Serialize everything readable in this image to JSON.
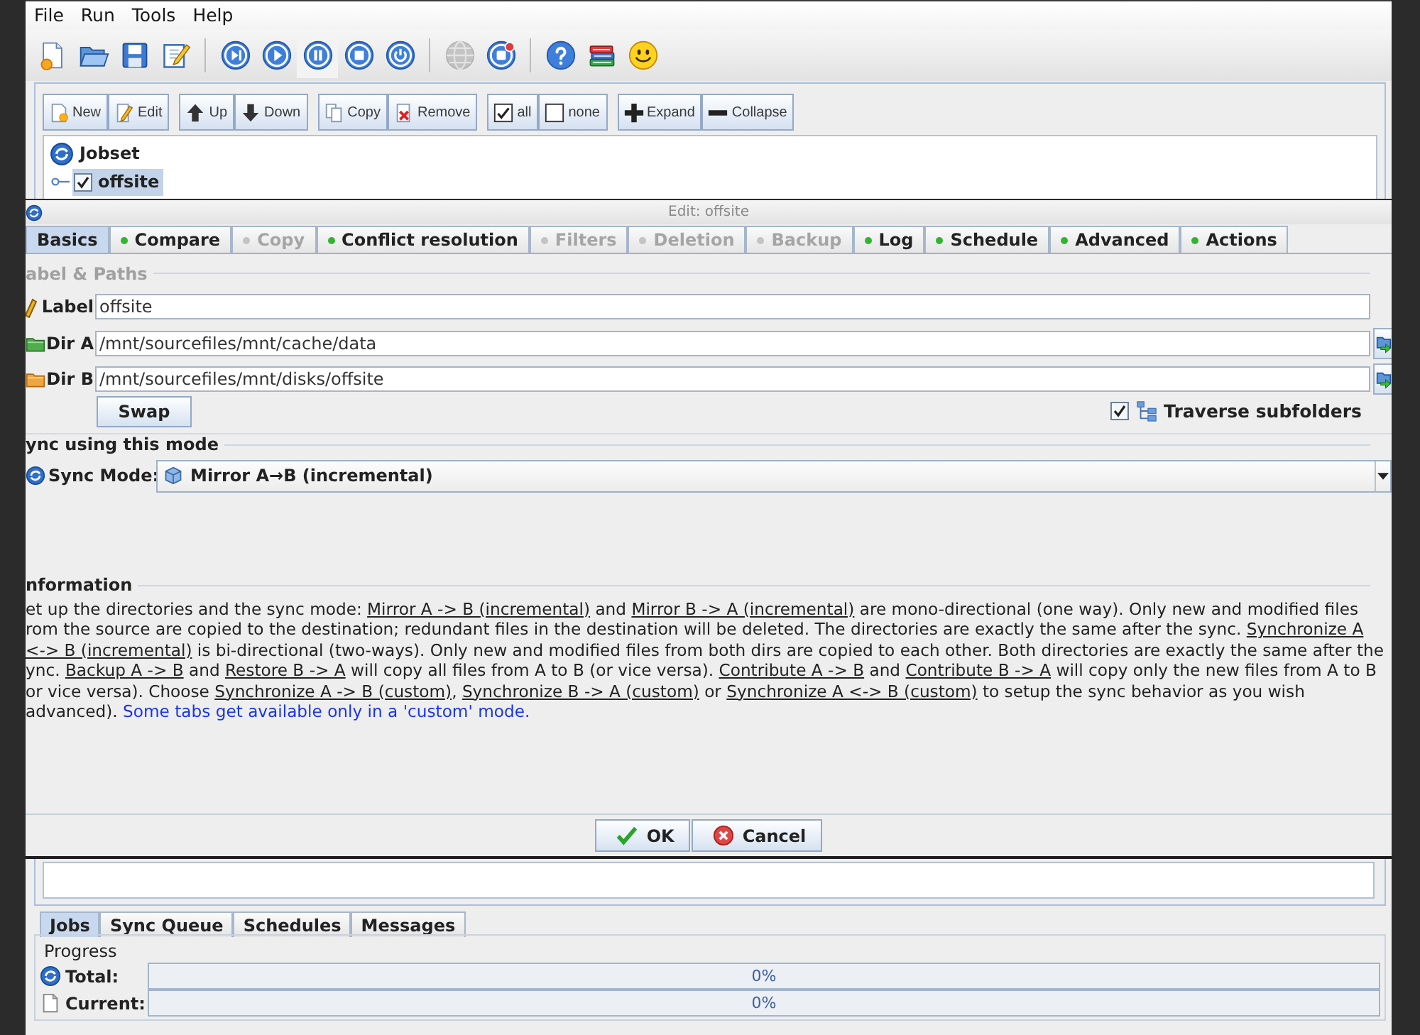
{
  "menu": [
    "File",
    "Run",
    "Tools",
    "Help"
  ],
  "toolbar": [
    {
      "items": [
        {
          "kind": "new",
          "highlighted": false,
          "disabled": false
        },
        {
          "kind": "open",
          "highlighted": false,
          "disabled": false
        },
        {
          "kind": "save",
          "highlighted": false,
          "disabled": false
        },
        {
          "kind": "edit",
          "highlighted": false,
          "disabled": false
        }
      ]
    },
    {
      "items": [
        {
          "kind": "skip",
          "highlighted": false,
          "disabled": false
        },
        {
          "kind": "play",
          "highlighted": false,
          "disabled": false
        },
        {
          "kind": "pause",
          "highlighted": true,
          "disabled": false
        },
        {
          "kind": "stop",
          "highlighted": false,
          "disabled": false
        },
        {
          "kind": "power",
          "highlighted": false,
          "disabled": false
        }
      ]
    },
    {
      "items": [
        {
          "kind": "globe",
          "highlighted": false,
          "disabled": true
        },
        {
          "kind": "badge",
          "highlighted": false,
          "disabled": false
        }
      ]
    },
    {
      "items": [
        {
          "kind": "help",
          "highlighted": false,
          "disabled": false
        },
        {
          "kind": "books",
          "highlighted": false,
          "disabled": false
        },
        {
          "kind": "smiley",
          "highlighted": false,
          "disabled": false
        }
      ]
    }
  ],
  "job_buttons": [
    {
      "buttons": [
        {
          "kind": "new",
          "label": "New"
        },
        {
          "kind": "edit",
          "label": "Edit"
        }
      ]
    },
    {
      "buttons": [
        {
          "kind": "up",
          "label": "Up"
        },
        {
          "kind": "down",
          "label": "Down"
        }
      ]
    },
    {
      "buttons": [
        {
          "kind": "copy",
          "label": "Copy"
        },
        {
          "kind": "remove",
          "label": "Remove"
        }
      ]
    },
    {
      "buttons": [
        {
          "kind": "all",
          "label": "all"
        },
        {
          "kind": "none",
          "label": "none"
        }
      ]
    },
    {
      "buttons": [
        {
          "kind": "expand",
          "label": "Expand"
        },
        {
          "kind": "collapse",
          "label": "Collapse"
        }
      ]
    }
  ],
  "job_tree": [
    {
      "kind": "root",
      "label": "Jobset",
      "selected": false,
      "children": [
        {
          "kind": "job",
          "label": "offsite",
          "selected": true,
          "checked": true
        }
      ]
    }
  ],
  "dialog": {
    "title": "Edit: offsite",
    "tabs": [
      {
        "label": "Basics",
        "selected": true,
        "disabled": false,
        "dot": false
      },
      {
        "label": "Compare",
        "selected": false,
        "disabled": false,
        "dot": true
      },
      {
        "label": "Copy",
        "selected": false,
        "disabled": true,
        "dot": true
      },
      {
        "label": "Conflict resolution",
        "selected": false,
        "disabled": false,
        "dot": true
      },
      {
        "label": "Filters",
        "selected": false,
        "disabled": true,
        "dot": true
      },
      {
        "label": "Deletion",
        "selected": false,
        "disabled": true,
        "dot": true
      },
      {
        "label": "Backup",
        "selected": false,
        "disabled": true,
        "dot": true
      },
      {
        "label": "Log",
        "selected": false,
        "disabled": false,
        "dot": true
      },
      {
        "label": "Schedule",
        "selected": false,
        "disabled": false,
        "dot": true
      },
      {
        "label": "Advanced",
        "selected": false,
        "disabled": false,
        "dot": true
      },
      {
        "label": "Actions",
        "selected": false,
        "disabled": false,
        "dot": true
      }
    ],
    "paths_group": {
      "title": "abel & Paths",
      "fields": [
        {
          "kind": "label",
          "label": "Label",
          "value": "offsite"
        },
        {
          "kind": "dir_a",
          "label": "Dir A",
          "value": "/mnt/sourcefiles/mnt/cache/data"
        },
        {
          "kind": "dir_b",
          "label": "Dir B",
          "value": "/mnt/sourcefiles/mnt/disks/offsite"
        }
      ],
      "swap_button": "Swap",
      "traverse": {
        "label": "Traverse subfolders",
        "checked": true
      }
    },
    "sync_group": {
      "title": "ync using this mode",
      "label": "Sync Mode:",
      "value": "Mirror A→B (incremental)"
    },
    "information": {
      "title": "nformation",
      "lines": [
        [
          {
            "kind": "plain",
            "text": "et up the directories and the sync mode: "
          },
          {
            "kind": "underlined",
            "text": "Mirror A -> B (incremental)"
          },
          {
            "kind": "plain",
            "text": " and "
          },
          {
            "kind": "underlined",
            "text": "Mirror B -> A (incremental)"
          },
          {
            "kind": "plain",
            "text": " are mono-directional (one way). Only new and modified files"
          }
        ],
        [
          {
            "kind": "plain",
            "text": "rom the source are copied to the destination; redundant files in the destination will be deleted. The directories are exactly the same after the sync. "
          },
          {
            "kind": "underlined",
            "text": "Synchronize A"
          }
        ],
        [
          {
            "kind": "underlined",
            "text": "<-> B (incremental)"
          },
          {
            "kind": "plain",
            "text": " is bi-directional (two-ways). Only new and modified files from both dirs are copied to each other. Both directories are exactly the same after the"
          }
        ],
        [
          {
            "kind": "plain",
            "text": "ync. "
          },
          {
            "kind": "underlined",
            "text": "Backup A -> B"
          },
          {
            "kind": "plain",
            "text": " and "
          },
          {
            "kind": "underlined",
            "text": "Restore B -> A"
          },
          {
            "kind": "plain",
            "text": " will copy all files from A to B (or vice versa). "
          },
          {
            "kind": "underlined",
            "text": "Contribute A -> B"
          },
          {
            "kind": "plain",
            "text": " and "
          },
          {
            "kind": "underlined",
            "text": "Contribute B -> A"
          },
          {
            "kind": "plain",
            "text": " will copy only the new files from A to B"
          }
        ],
        [
          {
            "kind": "plain",
            "text": "or vice versa). Choose "
          },
          {
            "kind": "underlined",
            "text": "Synchronize A -> B (custom)"
          },
          {
            "kind": "plain",
            "text": ", "
          },
          {
            "kind": "underlined",
            "text": "Synchronize B -> A (custom)"
          },
          {
            "kind": "plain",
            "text": " or "
          },
          {
            "kind": "underlined",
            "text": "Synchronize A <-> B (custom)"
          },
          {
            "kind": "plain",
            "text": " to setup the sync behavior as you wish"
          }
        ],
        [
          {
            "kind": "plain",
            "text": "advanced). "
          },
          {
            "kind": "note",
            "text": "Some tabs get available only in a 'custom' mode."
          }
        ]
      ]
    },
    "buttons": [
      {
        "kind": "ok",
        "label": "OK"
      },
      {
        "kind": "cancel",
        "label": "Cancel"
      }
    ]
  },
  "bottom_tabs": [
    {
      "label": "Jobs",
      "selected": true
    },
    {
      "label": "Sync Queue",
      "selected": false
    },
    {
      "label": "Schedules",
      "selected": false
    },
    {
      "label": "Messages",
      "selected": false
    }
  ],
  "progress": {
    "title": "Progress",
    "rows": [
      {
        "kind": "total",
        "label": "Total:",
        "level": 0,
        "reading": "0%"
      },
      {
        "kind": "current",
        "label": "Current:",
        "level": 0,
        "reading": "0%"
      }
    ]
  }
}
